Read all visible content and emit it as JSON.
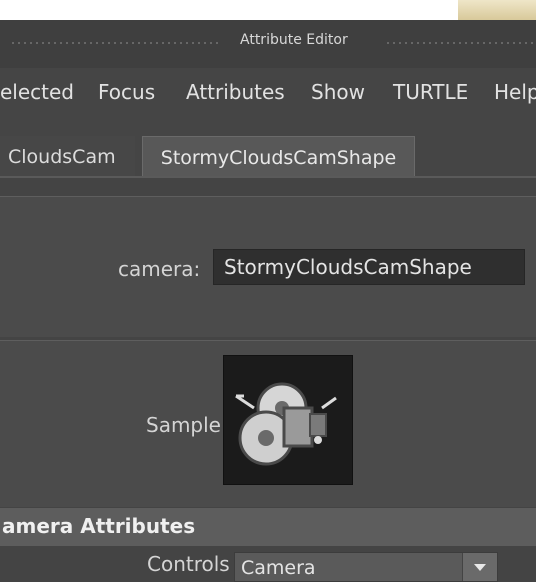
{
  "window": {
    "title": "Attribute Editor"
  },
  "menu": {
    "items": [
      {
        "label": "elected"
      },
      {
        "label": "Focus"
      },
      {
        "label": "Attributes"
      },
      {
        "label": "Show"
      },
      {
        "label": "TURTLE"
      },
      {
        "label": "Help"
      }
    ]
  },
  "tabs": [
    {
      "label": "CloudsCam"
    },
    {
      "label": "StormyCloudsCamShape"
    }
  ],
  "camera": {
    "label": "camera:",
    "value": "StormyCloudsCamShape"
  },
  "sample": {
    "label": "Sample",
    "icon": "camera-icon"
  },
  "section": {
    "title": "amera Attributes"
  },
  "controls": {
    "label": "Controls",
    "value": "Camera",
    "icon": "dropdown-arrow-icon"
  },
  "colors": {
    "panel": "#4b4b4b",
    "field": "#2f2f2f",
    "section_header": "#5d5d5d"
  }
}
